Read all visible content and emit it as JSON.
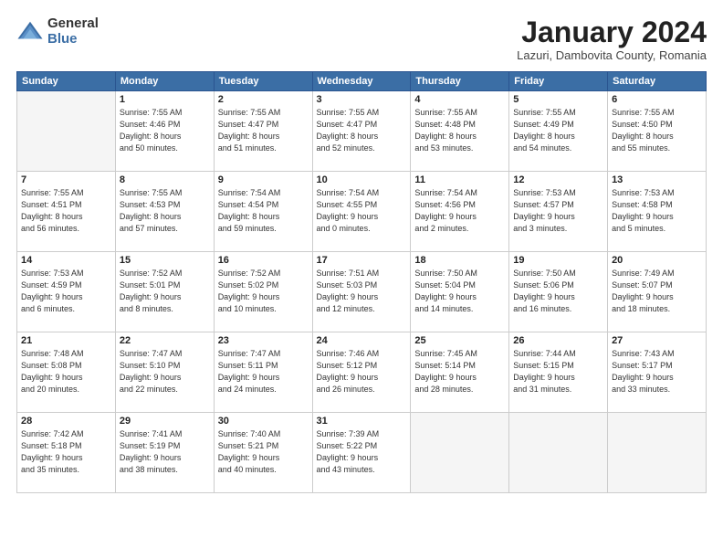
{
  "logo": {
    "general": "General",
    "blue": "Blue"
  },
  "header": {
    "title": "January 2024",
    "location": "Lazuri, Dambovita County, Romania"
  },
  "weekdays": [
    "Sunday",
    "Monday",
    "Tuesday",
    "Wednesday",
    "Thursday",
    "Friday",
    "Saturday"
  ],
  "weeks": [
    [
      {
        "day": "",
        "info": ""
      },
      {
        "day": "1",
        "info": "Sunrise: 7:55 AM\nSunset: 4:46 PM\nDaylight: 8 hours\nand 50 minutes."
      },
      {
        "day": "2",
        "info": "Sunrise: 7:55 AM\nSunset: 4:47 PM\nDaylight: 8 hours\nand 51 minutes."
      },
      {
        "day": "3",
        "info": "Sunrise: 7:55 AM\nSunset: 4:47 PM\nDaylight: 8 hours\nand 52 minutes."
      },
      {
        "day": "4",
        "info": "Sunrise: 7:55 AM\nSunset: 4:48 PM\nDaylight: 8 hours\nand 53 minutes."
      },
      {
        "day": "5",
        "info": "Sunrise: 7:55 AM\nSunset: 4:49 PM\nDaylight: 8 hours\nand 54 minutes."
      },
      {
        "day": "6",
        "info": "Sunrise: 7:55 AM\nSunset: 4:50 PM\nDaylight: 8 hours\nand 55 minutes."
      }
    ],
    [
      {
        "day": "7",
        "info": "Sunrise: 7:55 AM\nSunset: 4:51 PM\nDaylight: 8 hours\nand 56 minutes."
      },
      {
        "day": "8",
        "info": "Sunrise: 7:55 AM\nSunset: 4:53 PM\nDaylight: 8 hours\nand 57 minutes."
      },
      {
        "day": "9",
        "info": "Sunrise: 7:54 AM\nSunset: 4:54 PM\nDaylight: 8 hours\nand 59 minutes."
      },
      {
        "day": "10",
        "info": "Sunrise: 7:54 AM\nSunset: 4:55 PM\nDaylight: 9 hours\nand 0 minutes."
      },
      {
        "day": "11",
        "info": "Sunrise: 7:54 AM\nSunset: 4:56 PM\nDaylight: 9 hours\nand 2 minutes."
      },
      {
        "day": "12",
        "info": "Sunrise: 7:53 AM\nSunset: 4:57 PM\nDaylight: 9 hours\nand 3 minutes."
      },
      {
        "day": "13",
        "info": "Sunrise: 7:53 AM\nSunset: 4:58 PM\nDaylight: 9 hours\nand 5 minutes."
      }
    ],
    [
      {
        "day": "14",
        "info": "Sunrise: 7:53 AM\nSunset: 4:59 PM\nDaylight: 9 hours\nand 6 minutes."
      },
      {
        "day": "15",
        "info": "Sunrise: 7:52 AM\nSunset: 5:01 PM\nDaylight: 9 hours\nand 8 minutes."
      },
      {
        "day": "16",
        "info": "Sunrise: 7:52 AM\nSunset: 5:02 PM\nDaylight: 9 hours\nand 10 minutes."
      },
      {
        "day": "17",
        "info": "Sunrise: 7:51 AM\nSunset: 5:03 PM\nDaylight: 9 hours\nand 12 minutes."
      },
      {
        "day": "18",
        "info": "Sunrise: 7:50 AM\nSunset: 5:04 PM\nDaylight: 9 hours\nand 14 minutes."
      },
      {
        "day": "19",
        "info": "Sunrise: 7:50 AM\nSunset: 5:06 PM\nDaylight: 9 hours\nand 16 minutes."
      },
      {
        "day": "20",
        "info": "Sunrise: 7:49 AM\nSunset: 5:07 PM\nDaylight: 9 hours\nand 18 minutes."
      }
    ],
    [
      {
        "day": "21",
        "info": "Sunrise: 7:48 AM\nSunset: 5:08 PM\nDaylight: 9 hours\nand 20 minutes."
      },
      {
        "day": "22",
        "info": "Sunrise: 7:47 AM\nSunset: 5:10 PM\nDaylight: 9 hours\nand 22 minutes."
      },
      {
        "day": "23",
        "info": "Sunrise: 7:47 AM\nSunset: 5:11 PM\nDaylight: 9 hours\nand 24 minutes."
      },
      {
        "day": "24",
        "info": "Sunrise: 7:46 AM\nSunset: 5:12 PM\nDaylight: 9 hours\nand 26 minutes."
      },
      {
        "day": "25",
        "info": "Sunrise: 7:45 AM\nSunset: 5:14 PM\nDaylight: 9 hours\nand 28 minutes."
      },
      {
        "day": "26",
        "info": "Sunrise: 7:44 AM\nSunset: 5:15 PM\nDaylight: 9 hours\nand 31 minutes."
      },
      {
        "day": "27",
        "info": "Sunrise: 7:43 AM\nSunset: 5:17 PM\nDaylight: 9 hours\nand 33 minutes."
      }
    ],
    [
      {
        "day": "28",
        "info": "Sunrise: 7:42 AM\nSunset: 5:18 PM\nDaylight: 9 hours\nand 35 minutes."
      },
      {
        "day": "29",
        "info": "Sunrise: 7:41 AM\nSunset: 5:19 PM\nDaylight: 9 hours\nand 38 minutes."
      },
      {
        "day": "30",
        "info": "Sunrise: 7:40 AM\nSunset: 5:21 PM\nDaylight: 9 hours\nand 40 minutes."
      },
      {
        "day": "31",
        "info": "Sunrise: 7:39 AM\nSunset: 5:22 PM\nDaylight: 9 hours\nand 43 minutes."
      },
      {
        "day": "",
        "info": ""
      },
      {
        "day": "",
        "info": ""
      },
      {
        "day": "",
        "info": ""
      }
    ]
  ]
}
